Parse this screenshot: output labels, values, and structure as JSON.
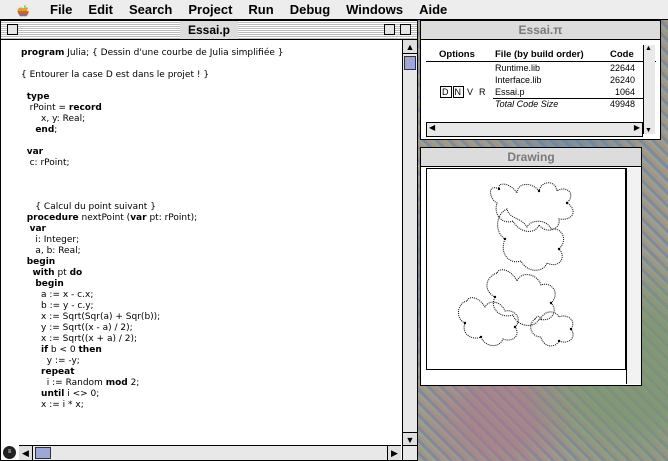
{
  "menubar": {
    "items": [
      "File",
      "Edit",
      "Search",
      "Project",
      "Run",
      "Debug",
      "Windows",
      "Aide"
    ]
  },
  "editor": {
    "title": "Essai.p",
    "lines": [
      "program Julia; { Dessin d'une courbe de Julia simplifiée }",
      "",
      "{ Entourer la case D est dans le projet ! }",
      "",
      "  type",
      "   rPoint = record",
      "       x, y: Real;",
      "     end;",
      "",
      "  var",
      "   c: rPoint;",
      "",
      "",
      "",
      "     { Calcul du point suivant }",
      "  procedure nextPoint (var pt: rPoint);",
      "   var",
      "     i: Integer;",
      "     a, b: Real;",
      "  begin",
      "    with pt do",
      "     begin",
      "       a := x - c.x;",
      "       b := y - c.y;",
      "       x := Sqrt(Sqr(a) + Sqr(b));",
      "       y := Sqrt((x - a) / 2);",
      "       x := Sqrt((x + a) / 2);",
      "       if b < 0 then",
      "         y := -y;",
      "       repeat",
      "         i := Random mod 2;",
      "       until i <> 0;",
      "       x := i * x;"
    ]
  },
  "project": {
    "title": "Essai.π",
    "headers": {
      "options": "Options",
      "file": "File (by build order)",
      "code": "Code"
    },
    "rows": [
      {
        "options": "",
        "file": "Runtime.lib",
        "code": "22644"
      },
      {
        "options": "",
        "file": "Interface.lib",
        "code": "26240"
      },
      {
        "options": "D N V R",
        "file": "Essai.p",
        "code": "1064"
      }
    ],
    "total_label": "Total Code Size",
    "total_value": "49948"
  },
  "drawing": {
    "title": "Drawing"
  },
  "colors": {
    "scroll_thumb": "#9fa6d8",
    "menubar_bg": "#ededed"
  }
}
